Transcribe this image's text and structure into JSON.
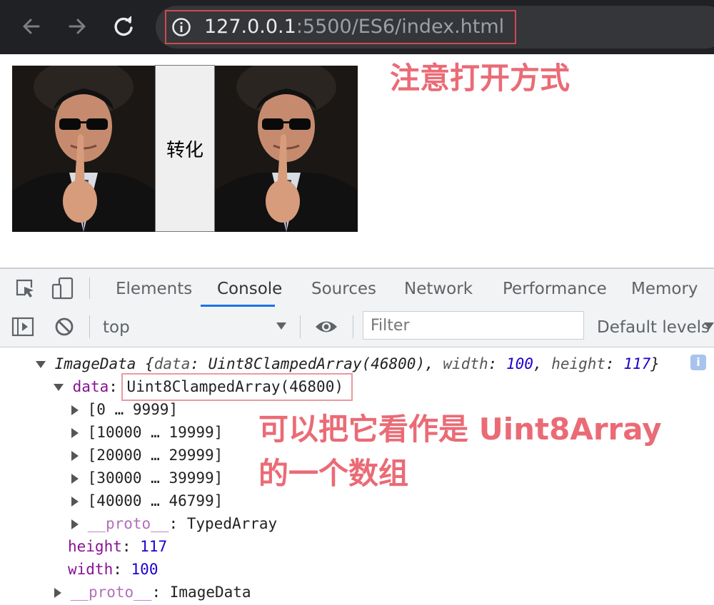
{
  "browser": {
    "url_host": "127.0.0.1",
    "url_rest": ":5500/ES6/index.html",
    "icons": [
      "back-arrow-icon",
      "forward-arrow-icon",
      "reload-icon",
      "site-info-icon"
    ]
  },
  "page": {
    "convert_button": "转化",
    "image_left": "portrait photo",
    "image_right": "portrait photo"
  },
  "annotations": {
    "open_method": "注意打开方式",
    "array_line1": "可以把它看作是 Uint8Array",
    "array_line2": "的一个数组",
    "color": "#ea6b76"
  },
  "devtools": {
    "tabs": [
      "Elements",
      "Console",
      "Sources",
      "Network",
      "Performance",
      "Memory"
    ],
    "active_tab": "Console",
    "context": "top",
    "filter_placeholder": "Filter",
    "levels": "Default levels"
  },
  "console": {
    "summary_type": "ImageData",
    "summary_open": "{",
    "summary_data_key": "data",
    "summary_data_val": "Uint8ClampedArray(46800)",
    "summary_width_key": "width",
    "summary_width_val": "100",
    "summary_height_key": "height",
    "summary_height_val": "117",
    "summary_close": "}",
    "data_key": "data",
    "data_val": "Uint8ClampedArray(46800)",
    "ranges": [
      "[0 … 9999]",
      "[10000 … 19999]",
      "[20000 … 29999]",
      "[30000 … 39999]",
      "[40000 … 46799]"
    ],
    "proto_key": "__proto__",
    "proto_typed": "TypedArray",
    "height_key": "height",
    "height_val": "117",
    "width_key": "width",
    "width_val": "100",
    "proto_imagedata": "ImageData"
  }
}
